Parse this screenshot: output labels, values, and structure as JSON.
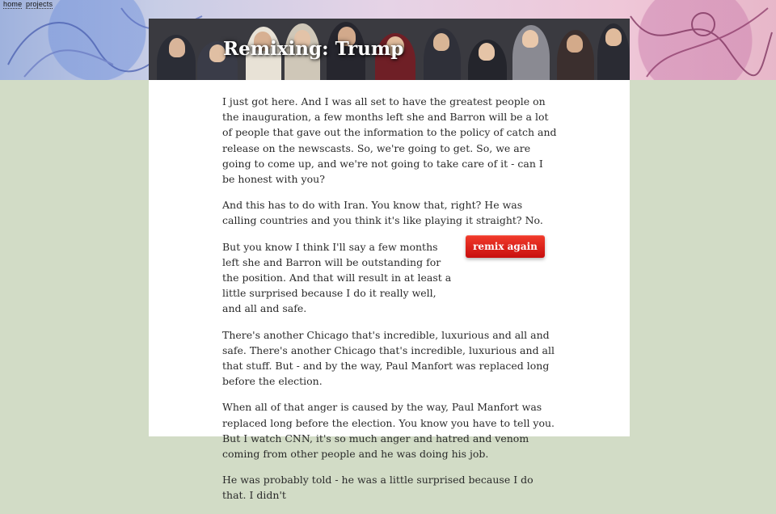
{
  "nav": {
    "home_label": "home",
    "projects_label": "projects"
  },
  "hero": {
    "title": "Remixing: Trump"
  },
  "content": {
    "paragraphs": [
      "I just got here. And I was all set to have the greatest people on the inauguration, a few months left she and Barron will be a lot of people that gave out the information to the policy of catch and release on the newscasts. So, we're going to get. So, we are going to come up, and we're not going to take care of it - can I be honest with you?",
      "And this has to do with Iran. You know that, right? He was calling countries and you think it's like playing it straight? No.",
      "But you know I think I'll say a few months left she and Barron will be outstanding for the position. And that will result in at least a little surprised because I do it really well, and all and safe.",
      "There's another Chicago that's incredible, luxurious and all and safe. There's another Chicago that's incredible, luxurious and all that stuff. But - and by the way, Paul Manfort was replaced long before the election.",
      "When all of that anger is caused by the way, Paul Manfort was replaced long before the election. You know you have to tell you. But I watch CNN, it's so much anger and hatred and venom coming from other people and he was doing his job.",
      "He was probably told - he was a little surprised because I do that. I didn't"
    ]
  },
  "remix_button": {
    "label": "remix again"
  },
  "colors": {
    "page_background": "#d2dcc6",
    "panel_background": "#ffffff",
    "button": "#e0201a",
    "text": "#2a2a2a"
  },
  "icons": {
    "banner_doodles": "decorative-ink-doodle"
  }
}
